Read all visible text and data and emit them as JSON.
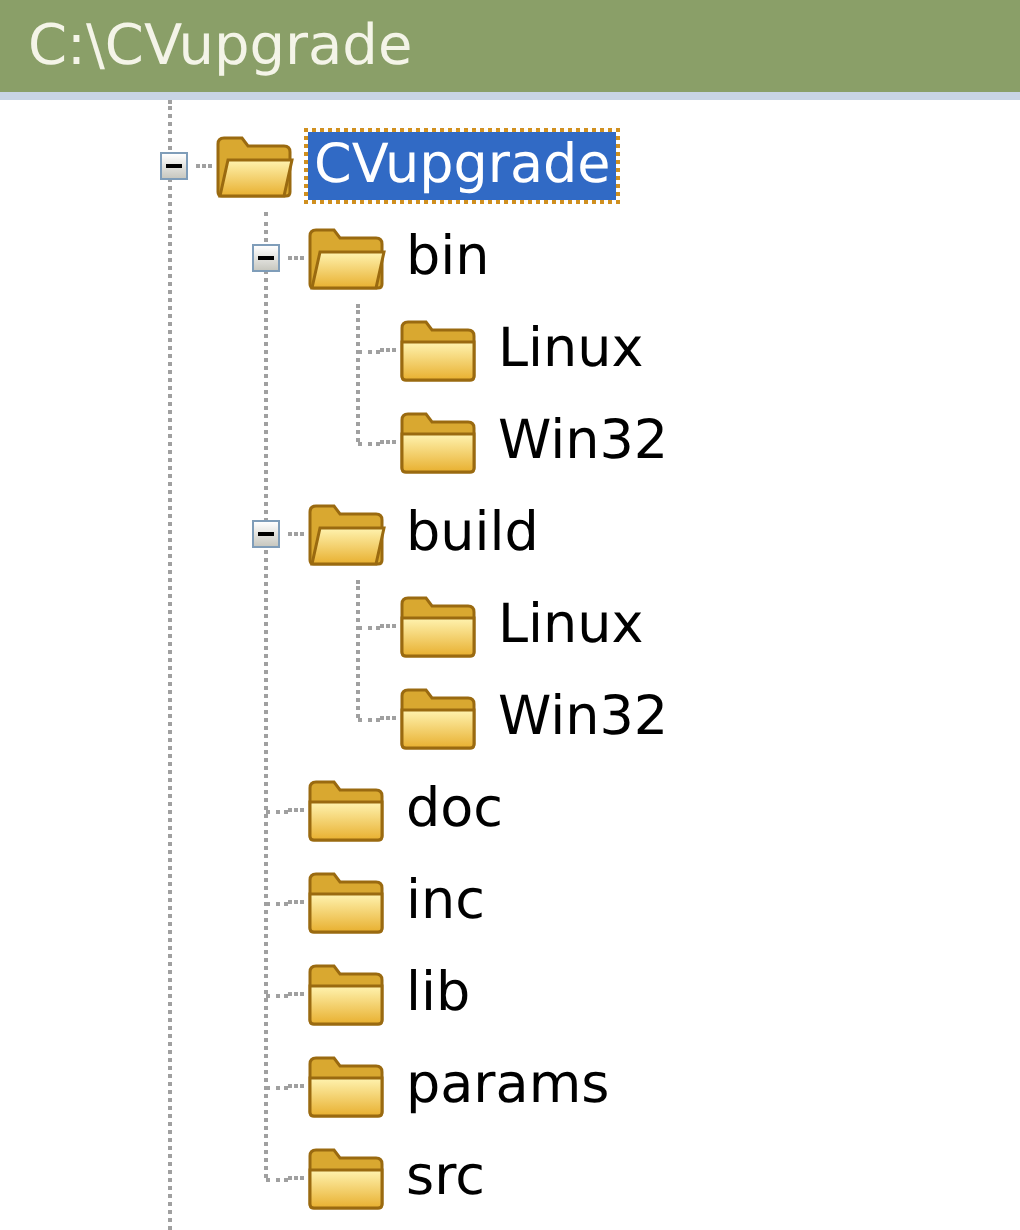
{
  "header": {
    "title": "C:\\CVupgrade"
  },
  "tree": [
    {
      "label": "CVupgrade",
      "selected": true,
      "expanded": true,
      "children": [
        {
          "label": "bin",
          "selected": false,
          "expanded": true,
          "children": [
            {
              "label": "Linux",
              "selected": false
            },
            {
              "label": "Win32",
              "selected": false
            }
          ]
        },
        {
          "label": "build",
          "selected": false,
          "expanded": true,
          "children": [
            {
              "label": "Linux",
              "selected": false
            },
            {
              "label": "Win32",
              "selected": false
            }
          ]
        },
        {
          "label": "doc",
          "selected": false
        },
        {
          "label": "inc",
          "selected": false
        },
        {
          "label": "lib",
          "selected": false
        },
        {
          "label": "params",
          "selected": false
        },
        {
          "label": "src",
          "selected": false
        }
      ]
    }
  ]
}
